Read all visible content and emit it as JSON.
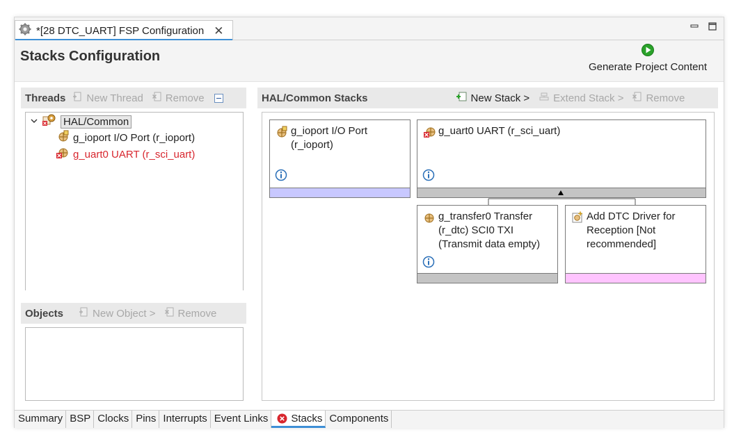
{
  "editor_tab": {
    "title": "*[28 DTC_UART] FSP Configuration",
    "close": "✕",
    "icon": "gear-icon"
  },
  "window_controls": {
    "minimize": "▭",
    "maximize": "☐"
  },
  "header": {
    "title": "Stacks Configuration",
    "generate_label": "Generate Project Content"
  },
  "threads": {
    "title": "Threads",
    "new_thread": "New Thread",
    "remove": "Remove",
    "tree": {
      "root": "HAL/Common",
      "items": [
        {
          "label": "g_ioport I/O Port (r_ioport)",
          "error": false
        },
        {
          "label": "g_uart0 UART (r_sci_uart)",
          "error": true
        }
      ]
    }
  },
  "objects": {
    "title": "Objects",
    "new_object": "New Object >",
    "remove": "Remove"
  },
  "stacks": {
    "title": "HAL/Common Stacks",
    "new_stack": "New Stack >",
    "extend_stack": "Extend Stack >",
    "remove": "Remove",
    "blocks": {
      "ioport": {
        "line1": "g_ioport I/O Port",
        "line2": "(r_ioport)",
        "bar_color": "#c8c8ff"
      },
      "uart": {
        "line1": "g_uart0 UART (r_sci_uart)",
        "bar_color": "#c4c4c4",
        "error": true
      },
      "transfer": {
        "line1": "g_transfer0 Transfer",
        "line2": "(r_dtc) SCI0 TXI",
        "line3": "(Transmit data empty)",
        "bar_color": "#c4c4c4"
      },
      "dtc_rx": {
        "line1": "Add DTC Driver for",
        "line2": "Reception [Not",
        "line3": "recommended]",
        "bar_color": "#ffc4ff"
      }
    }
  },
  "bottom_tabs": [
    "Summary",
    "BSP",
    "Clocks",
    "Pins",
    "Interrupts",
    "Event Links",
    "Stacks",
    "Components"
  ],
  "selected_bottom_tab": "Stacks",
  "colors": {
    "accent": "#3d8fd6",
    "error": "#d8262e",
    "play_green": "#2aa22a"
  }
}
